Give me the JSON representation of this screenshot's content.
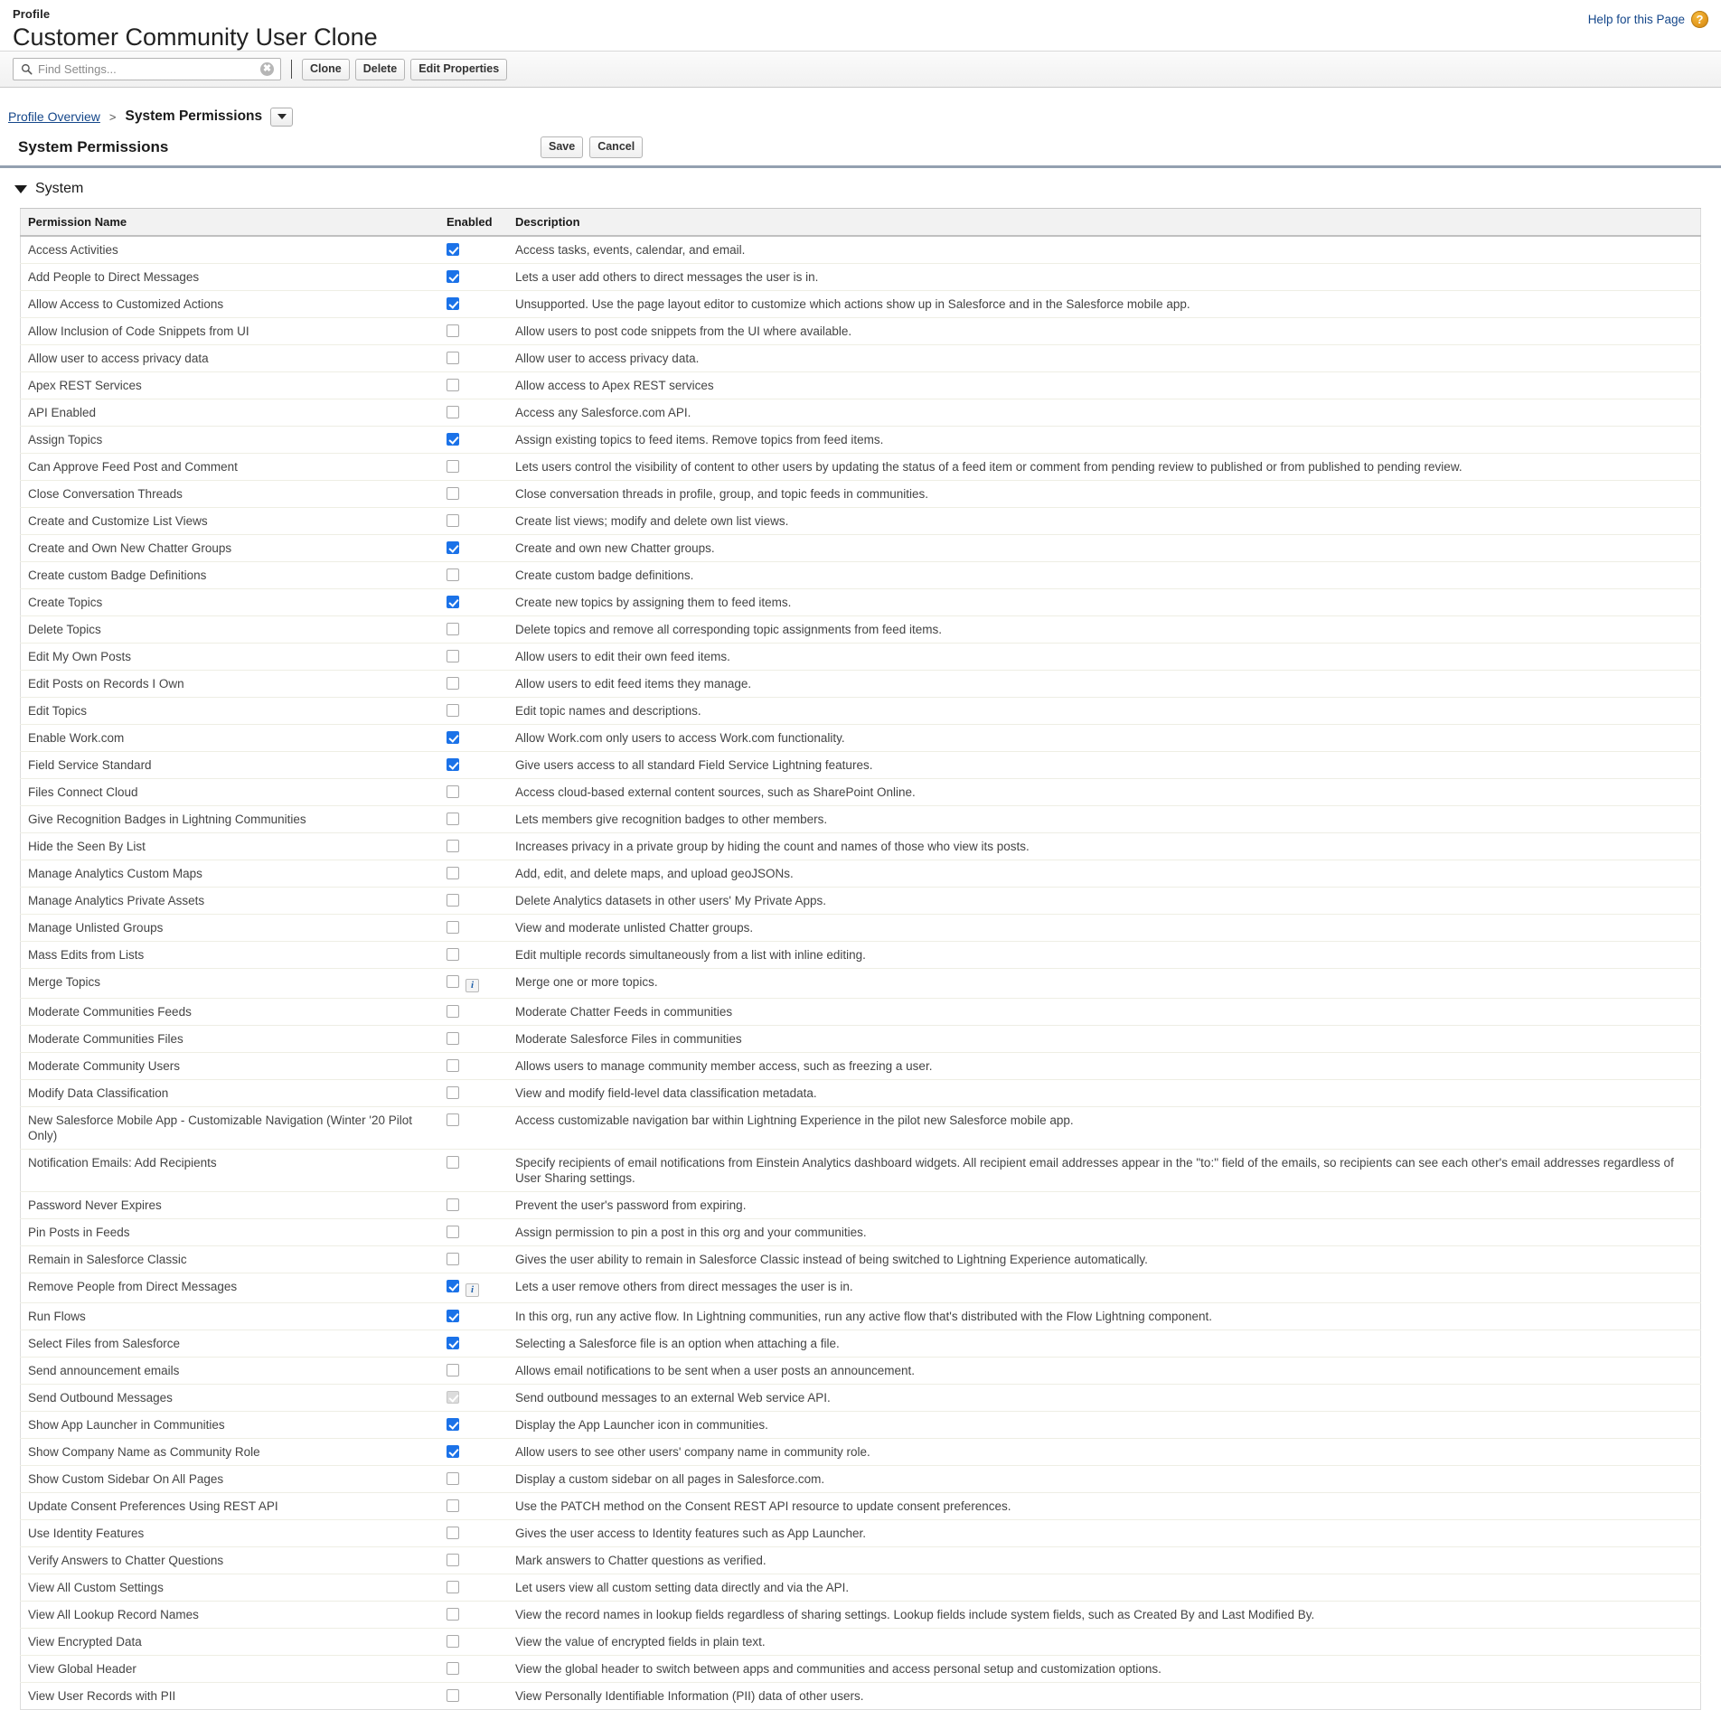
{
  "header": {
    "eyebrow": "Profile",
    "title": "Customer Community User Clone",
    "help_label": "Help for this Page",
    "help_badge": "?"
  },
  "toolbar": {
    "search_placeholder": "Find Settings...",
    "search_value": "",
    "search_icon": "search-icon",
    "clear_glyph": "✖",
    "clone_label": "Clone",
    "delete_label": "Delete",
    "edit_properties_label": "Edit Properties"
  },
  "breadcrumb": {
    "parent_label": "Profile Overview",
    "separator": ">",
    "current_label": "System Permissions"
  },
  "section": {
    "title": "System Permissions",
    "save_label": "Save",
    "cancel_label": "Cancel",
    "group_label": "System"
  },
  "table": {
    "columns": {
      "name": "Permission Name",
      "enabled": "Enabled",
      "description": "Description"
    },
    "rows": [
      {
        "name": "Access Activities",
        "enabled": "checked",
        "info": false,
        "description": "Access tasks, events, calendar, and email."
      },
      {
        "name": "Add People to Direct Messages",
        "enabled": "checked",
        "info": false,
        "description": "Lets a user add others to direct messages the user is in."
      },
      {
        "name": "Allow Access to Customized Actions",
        "enabled": "checked",
        "info": false,
        "description": "Unsupported. Use the page layout editor to customize which actions show up in Salesforce and in the Salesforce mobile app."
      },
      {
        "name": "Allow Inclusion of Code Snippets from UI",
        "enabled": "unchecked",
        "info": false,
        "description": "Allow users to post code snippets from the UI where available."
      },
      {
        "name": "Allow user to access privacy data",
        "enabled": "unchecked",
        "info": false,
        "description": "Allow user to access privacy data."
      },
      {
        "name": "Apex REST Services",
        "enabled": "unchecked",
        "info": false,
        "description": "Allow access to Apex REST services"
      },
      {
        "name": "API Enabled",
        "enabled": "unchecked",
        "info": false,
        "description": "Access any Salesforce.com API."
      },
      {
        "name": "Assign Topics",
        "enabled": "checked",
        "info": false,
        "description": "Assign existing topics to feed items. Remove topics from feed items."
      },
      {
        "name": "Can Approve Feed Post and Comment",
        "enabled": "unchecked",
        "info": false,
        "description": "Lets users control the visibility of content to other users by updating the status of a feed item or comment from pending review to published or from published to pending review."
      },
      {
        "name": "Close Conversation Threads",
        "enabled": "unchecked",
        "info": false,
        "description": "Close conversation threads in profile, group, and topic feeds in communities."
      },
      {
        "name": "Create and Customize List Views",
        "enabled": "unchecked",
        "info": false,
        "description": "Create list views; modify and delete own list views."
      },
      {
        "name": "Create and Own New Chatter Groups",
        "enabled": "checked",
        "info": false,
        "description": "Create and own new Chatter groups."
      },
      {
        "name": "Create custom Badge Definitions",
        "enabled": "unchecked",
        "info": false,
        "description": "Create custom badge definitions."
      },
      {
        "name": "Create Topics",
        "enabled": "checked",
        "info": false,
        "description": "Create new topics by assigning them to feed items."
      },
      {
        "name": "Delete Topics",
        "enabled": "unchecked",
        "info": false,
        "description": "Delete topics and remove all corresponding topic assignments from feed items."
      },
      {
        "name": "Edit My Own Posts",
        "enabled": "unchecked",
        "info": false,
        "description": "Allow users to edit their own feed items."
      },
      {
        "name": "Edit Posts on Records I Own",
        "enabled": "unchecked",
        "info": false,
        "description": "Allow users to edit feed items they manage."
      },
      {
        "name": "Edit Topics",
        "enabled": "unchecked",
        "info": false,
        "description": "Edit topic names and descriptions."
      },
      {
        "name": "Enable Work.com",
        "enabled": "checked",
        "info": false,
        "description": "Allow Work.com only users to access Work.com functionality."
      },
      {
        "name": "Field Service Standard",
        "enabled": "checked",
        "info": false,
        "description": "Give users access to all standard Field Service Lightning features."
      },
      {
        "name": "Files Connect Cloud",
        "enabled": "unchecked",
        "info": false,
        "description": "Access cloud-based external content sources, such as SharePoint Online."
      },
      {
        "name": "Give Recognition Badges in Lightning Communities",
        "enabled": "unchecked",
        "info": false,
        "description": "Lets members give recognition badges to other members."
      },
      {
        "name": "Hide the Seen By List",
        "enabled": "unchecked",
        "info": false,
        "description": "Increases privacy in a private group by hiding the count and names of those who view its posts."
      },
      {
        "name": "Manage Analytics Custom Maps",
        "enabled": "unchecked",
        "info": false,
        "description": "Add, edit, and delete maps, and upload geoJSONs."
      },
      {
        "name": "Manage Analytics Private Assets",
        "enabled": "unchecked",
        "info": false,
        "description": "Delete Analytics datasets in other users' My Private Apps."
      },
      {
        "name": "Manage Unlisted Groups",
        "enabled": "unchecked",
        "info": false,
        "description": "View and moderate unlisted Chatter groups."
      },
      {
        "name": "Mass Edits from Lists",
        "enabled": "unchecked",
        "info": false,
        "description": "Edit multiple records simultaneously from a list with inline editing."
      },
      {
        "name": "Merge Topics",
        "enabled": "unchecked",
        "info": true,
        "description": "Merge one or more topics."
      },
      {
        "name": "Moderate Communities Feeds",
        "enabled": "unchecked",
        "info": false,
        "description": "Moderate Chatter Feeds in communities"
      },
      {
        "name": "Moderate Communities Files",
        "enabled": "unchecked",
        "info": false,
        "description": "Moderate Salesforce Files in communities"
      },
      {
        "name": "Moderate Community Users",
        "enabled": "unchecked",
        "info": false,
        "description": "Allows users to manage community member access, such as freezing a user."
      },
      {
        "name": "Modify Data Classification",
        "enabled": "unchecked",
        "info": false,
        "description": "View and modify field-level data classification metadata."
      },
      {
        "name": "New Salesforce Mobile App - Customizable Navigation (Winter '20 Pilot Only)",
        "enabled": "unchecked",
        "info": false,
        "description": "Access customizable navigation bar within Lightning Experience in the pilot new Salesforce mobile app."
      },
      {
        "name": "Notification Emails: Add Recipients",
        "enabled": "unchecked",
        "info": false,
        "description": "Specify recipients of email notifications from Einstein Analytics dashboard widgets. All recipient email addresses appear in the \"to:\" field of the emails, so recipients can see each other's email addresses regardless of User Sharing settings."
      },
      {
        "name": "Password Never Expires",
        "enabled": "unchecked",
        "info": false,
        "description": "Prevent the user's password from expiring."
      },
      {
        "name": "Pin Posts in Feeds",
        "enabled": "unchecked",
        "info": false,
        "description": "Assign permission to pin a post in this org and your communities."
      },
      {
        "name": "Remain in Salesforce Classic",
        "enabled": "unchecked",
        "info": false,
        "description": "Gives the user ability to remain in Salesforce Classic instead of being switched to Lightning Experience automatically."
      },
      {
        "name": "Remove People from Direct Messages",
        "enabled": "checked",
        "info": true,
        "description": "Lets a user remove others from direct messages the user is in."
      },
      {
        "name": "Run Flows",
        "enabled": "checked",
        "info": false,
        "description": "In this org, run any active flow. In Lightning communities, run any active flow that's distributed with the Flow Lightning component."
      },
      {
        "name": "Select Files from Salesforce",
        "enabled": "checked",
        "info": false,
        "description": "Selecting a Salesforce file is an option when attaching a file."
      },
      {
        "name": "Send announcement emails",
        "enabled": "unchecked",
        "info": false,
        "description": "Allows email notifications to be sent when a user posts an announcement."
      },
      {
        "name": "Send Outbound Messages",
        "enabled": "disabled-checked",
        "info": false,
        "description": "Send outbound messages to an external Web service API."
      },
      {
        "name": "Show App Launcher in Communities",
        "enabled": "checked",
        "info": false,
        "description": "Display the App Launcher icon in communities."
      },
      {
        "name": "Show Company Name as Community Role",
        "enabled": "checked",
        "info": false,
        "description": "Allow users to see other users' company name in community role."
      },
      {
        "name": "Show Custom Sidebar On All Pages",
        "enabled": "unchecked",
        "info": false,
        "description": "Display a custom sidebar on all pages in Salesforce.com."
      },
      {
        "name": "Update Consent Preferences Using REST API",
        "enabled": "unchecked",
        "info": false,
        "description": "Use the PATCH method on the Consent REST API resource to update consent preferences."
      },
      {
        "name": "Use Identity Features",
        "enabled": "unchecked",
        "info": false,
        "description": "Gives the user access to Identity features such as App Launcher."
      },
      {
        "name": "Verify Answers to Chatter Questions",
        "enabled": "unchecked",
        "info": false,
        "description": "Mark answers to Chatter questions as verified."
      },
      {
        "name": "View All Custom Settings",
        "enabled": "unchecked",
        "info": false,
        "description": "Let users view all custom setting data directly and via the API."
      },
      {
        "name": "View All Lookup Record Names",
        "enabled": "unchecked",
        "info": false,
        "description": "View the record names in lookup fields regardless of sharing settings. Lookup fields include system fields, such as Created By and Last Modified By."
      },
      {
        "name": "View Encrypted Data",
        "enabled": "unchecked",
        "info": false,
        "description": "View the value of encrypted fields in plain text."
      },
      {
        "name": "View Global Header",
        "enabled": "unchecked",
        "info": false,
        "description": "View the global header to switch between apps and communities and access personal setup and customization options."
      },
      {
        "name": "View User Records with PII",
        "enabled": "unchecked",
        "info": false,
        "description": "View Personally Identifiable Information (PII) data of other users."
      }
    ]
  },
  "colors": {
    "accent_blue": "#1b72e8",
    "link_blue": "#15478a",
    "help_orange": "#e49b20",
    "section_rule": "#93a0b0"
  }
}
